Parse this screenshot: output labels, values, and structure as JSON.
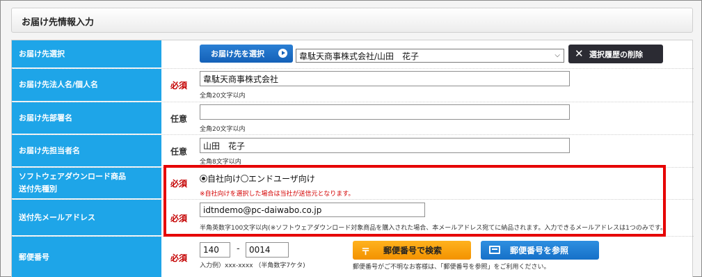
{
  "section_title": "お届け先情報入力",
  "rows": {
    "destination_select": {
      "label": "お届け先選択",
      "select_button": "お届け先を選択",
      "selected_value": "韋駄天商事株式会社/山田　花子",
      "clear_history_button": "選択履歴の削除"
    },
    "corp_name": {
      "label": "お届け先法人名/個人名",
      "required": "必須",
      "value": "韋駄天商事株式会社",
      "hint": "全角20文字以内"
    },
    "department": {
      "label": "お届け先部署名",
      "required": "任意",
      "value": "",
      "hint": "全角20文字以内"
    },
    "contact": {
      "label": "お届け先担当者名",
      "required": "任意",
      "value": "山田　花子",
      "hint": "全角8文字以内"
    },
    "software_dest": {
      "label_line1": "ソフトウェアダウンロード商品",
      "label_line2": "送付先種別",
      "required": "必須",
      "option1": "自社向け",
      "option2": "エンドユーザ向け",
      "selected": "option1",
      "warning": "※自社向けを選択した場合は当社が送信元となります。"
    },
    "email": {
      "label": "送付先メールアドレス",
      "required": "必須",
      "value": "idtndemo@pc-daiwabo.co.jp",
      "hint": "半角英数字100文字以内(※ソフトウェアダウンロード対象商品を購入された場合、本メールアドレス宛てに納品されます。入力できるメールアドレスは1つのみです。)"
    },
    "postal": {
      "label": "郵便番号",
      "required": "必須",
      "value1": "140",
      "separator": "-",
      "value2": "0014",
      "hint": "入力例）xxx-xxxx （半角数字7ケタ)",
      "search_button": "郵便番号で検索",
      "reference_button": "郵便番号を参照",
      "note": "郵便番号がご不明なお客様は、「郵便番号を参照」をご利用ください。"
    }
  },
  "colors": {
    "label_bg": "#1ea5e8",
    "required": "#c40000",
    "highlight": "#e60000",
    "search_button": "#f39200",
    "reference_button": "#1670c8"
  },
  "icons": [
    "play-circle-icon",
    "close-icon",
    "postal-mark-icon",
    "postal-book-icon",
    "chevron-down-icon"
  ]
}
